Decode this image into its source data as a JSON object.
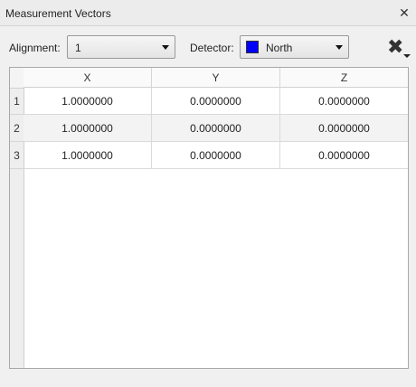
{
  "window": {
    "title": "Measurement Vectors"
  },
  "toolbar": {
    "alignment_label": "Alignment:",
    "alignment_value": "1",
    "detector_label": "Detector:",
    "detector_value": "North",
    "detector_color": "#0000ff"
  },
  "table": {
    "columns": [
      "X",
      "Y",
      "Z"
    ],
    "rows": [
      {
        "index": "1",
        "x": "1.0000000",
        "y": "0.0000000",
        "z": "0.0000000"
      },
      {
        "index": "2",
        "x": "1.0000000",
        "y": "0.0000000",
        "z": "0.0000000"
      },
      {
        "index": "3",
        "x": "1.0000000",
        "y": "0.0000000",
        "z": "0.0000000"
      }
    ]
  },
  "icons": {
    "close": "close-icon",
    "clear": "clear-x-icon",
    "clear_menu": "dropdown-arrow-icon"
  }
}
